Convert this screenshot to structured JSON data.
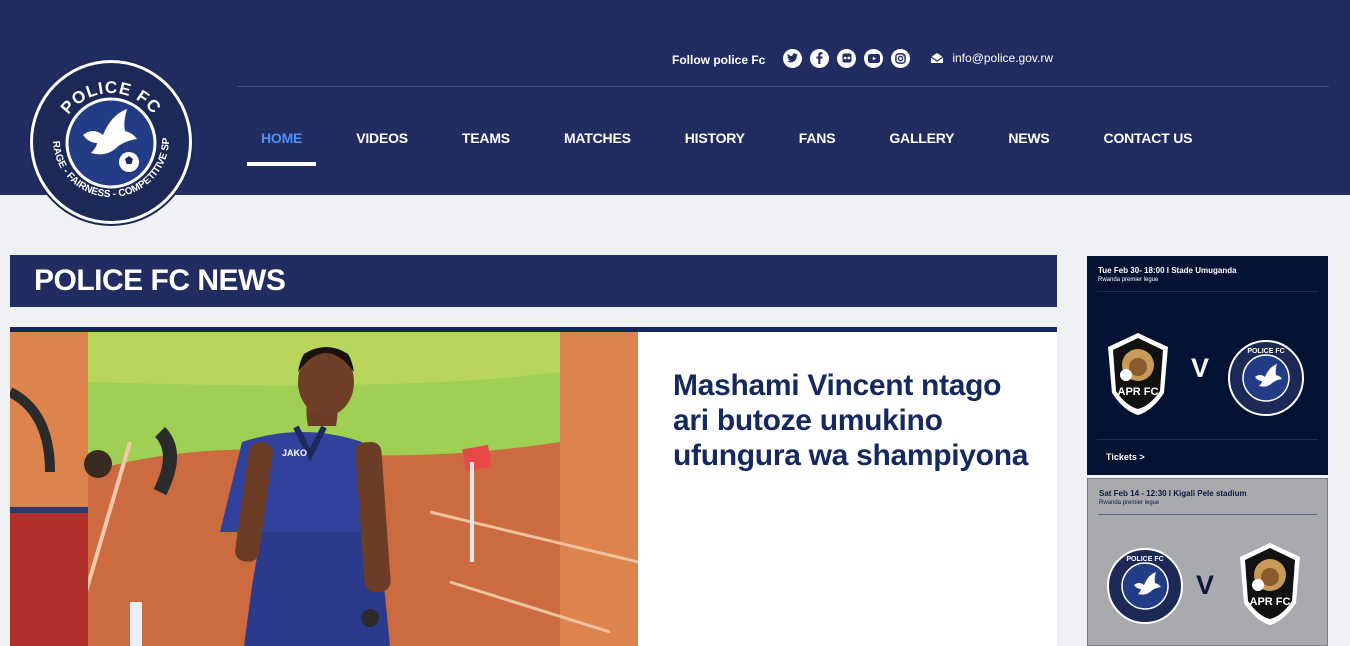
{
  "brand": {
    "name": "POLICE FC",
    "motto": "COURAGE - FAIRNESS - COMPETITIVE SPIRIT",
    "primary_color": "#212d61",
    "accent_color": "#4f8ef7"
  },
  "header": {
    "follow_label": "Follow police Fc",
    "social": [
      {
        "name": "twitter-icon"
      },
      {
        "name": "facebook-icon"
      },
      {
        "name": "flickr-icon"
      },
      {
        "name": "youtube-icon"
      },
      {
        "name": "instagram-icon"
      }
    ],
    "email": "info@police.gov.rw"
  },
  "nav": {
    "items": [
      {
        "label": "HOME",
        "active": true
      },
      {
        "label": "VIDEOS"
      },
      {
        "label": "TEAMS"
      },
      {
        "label": "MATCHES"
      },
      {
        "label": "HISTORY"
      },
      {
        "label": "FANS"
      },
      {
        "label": "GALLERY"
      },
      {
        "label": "NEWS"
      },
      {
        "label": "CONTACT US"
      }
    ]
  },
  "news": {
    "section_title": "POLICE FC NEWS",
    "featured": {
      "headline": "Mashami Vincent ntago ari butoze umukino ufungura wa shampiyona",
      "shirt_text": "JAKO"
    }
  },
  "matches": [
    {
      "date_venue": "Tue Feb 30- 18:00  I  Stade Umuganda",
      "league": "Rwanda premier legue",
      "home": "APR FC",
      "vs": "V",
      "away": "POLICE FC",
      "tickets": "Tickets >"
    },
    {
      "date_venue": "Sat Feb 14 - 12:30  I  Kigali Pele stadium",
      "league": "Rwanda premier legue",
      "home": "POLICE FC",
      "vs": "V",
      "away": "APR FC"
    }
  ]
}
